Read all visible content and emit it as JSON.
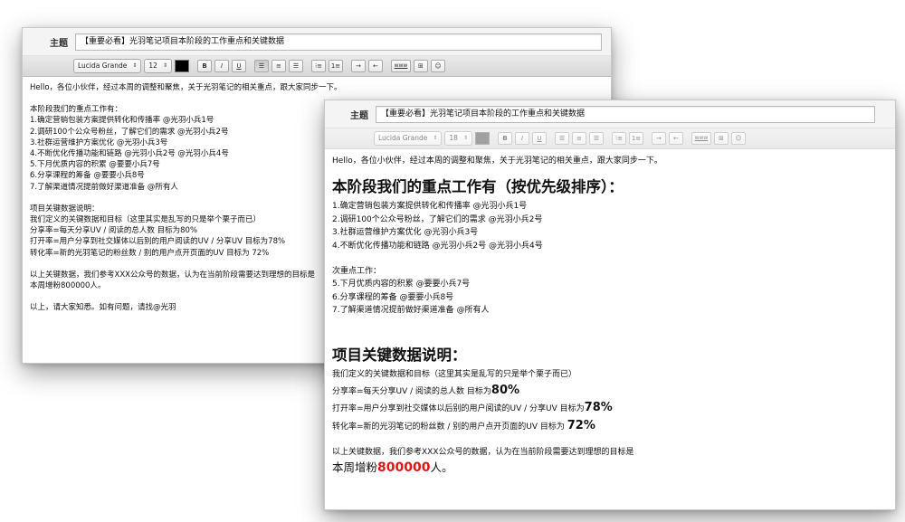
{
  "window1": {
    "subject_label": "主题",
    "subject_value": "【重要必看】光羽笔记项目本阶段的工作重点和关键数据",
    "toolbar": {
      "font": "Lucida Grande",
      "size": "12",
      "bold": "B",
      "italic": "I",
      "underline": "U",
      "link": "www"
    },
    "greeting": "Hello，各位小伙伴，经过本周的调整和聚焦，关于光羽笔记的相关重点，跟大家同步一下。",
    "priorities_title": "本阶段我们的重点工作有：",
    "priorities": [
      "1.确定营销包装方案提供转化和传播率 @光羽小兵1号",
      "2.调研100个公众号粉丝，了解它们的需求 @光羽小兵2号",
      "3.社群运营维护方案优化 @光羽小兵3号",
      "4.不断优化传播功能和链路 @光羽小兵2号 @光羽小兵4号",
      "5.下月优质内容的积累 @要要小兵7号",
      "6.分享课程的筹备 @要要小兵8号",
      "7.了解渠道情况提前做好渠道准备 @所有人"
    ],
    "metrics_title": "项目关键数据说明：",
    "metrics_intro": "我们定义的关键数据和目标（这里其实是乱写的只是举个栗子而已）",
    "metrics": [
      "分享率=每天分享UV / 阅读的总人数  目标为80%",
      "打开率=用户分享到社交媒体以后别的用户阅读的UV / 分享UV  目标为78%",
      "转化率=新的光羽笔记的粉丝数 / 别的用户点开页面的UV  目标为 72%"
    ],
    "target_line1": "以上关键数据，我们参考XXX公众号的数据，认为在当前阶段需要达到理想的目标是",
    "target_line2": "本周增粉800000人。",
    "closing": "以上，请大家知悉。如有问题，请找@光羽"
  },
  "window2": {
    "subject_label": "主题",
    "subject_value": "【重要必看】光羽笔记项目本阶段的工作重点和关键数据",
    "toolbar": {
      "font": "Lucida Grande",
      "size": "18",
      "bold": "B",
      "italic": "I",
      "underline": "U",
      "link": "www"
    },
    "greeting": "Hello，各位小伙伴，经过本周的调整和聚焦，关于光羽笔记的相关重点，跟大家同步一下。",
    "priorities_title": "本阶段我们的重点工作有（按优先级排序）：",
    "priorities": [
      "1.确定营销包装方案提供转化和传播率 @光羽小兵1号",
      "2.调研100个公众号粉丝，了解它们的需求 @光羽小兵2号",
      "3.社群运营维护方案优化  @光羽小兵3号",
      "4.不断优化传播功能和链路 @光羽小兵2号 @光羽小兵4号"
    ],
    "secondary_title": "次重点工作：",
    "secondary": [
      "5.下月优质内容的积累 @要要小兵7号",
      "6.分享课程的筹备 @要要小兵8号",
      "7.了解渠道情况提前做好渠道准备 @所有人"
    ],
    "metrics_title": "项目关键数据说明：",
    "metrics_intro": "我们定义的关键数据和目标（这里其实是乱写的只是举个栗子而已）",
    "metrics": [
      {
        "label": "分享率=每天分享UV / 阅读的总人数  目标为",
        "value": "80%"
      },
      {
        "label": "打开率=用户分享到社交媒体以后别的用户阅读的UV / 分享UV  目标为",
        "value": "78%"
      },
      {
        "label": "转化率=新的光羽笔记的粉丝数 / 别的用户点开页面的UV  目标为 ",
        "value": "72%"
      }
    ],
    "target_line1": "以上关键数据，我们参考XXX公众号的数据，认为在当前阶段需要达到理想的目标是",
    "target_prefix": "本周增粉",
    "target_value": "800000",
    "target_suffix": "人。"
  },
  "colors": {
    "highlight_red": "#e01515"
  }
}
